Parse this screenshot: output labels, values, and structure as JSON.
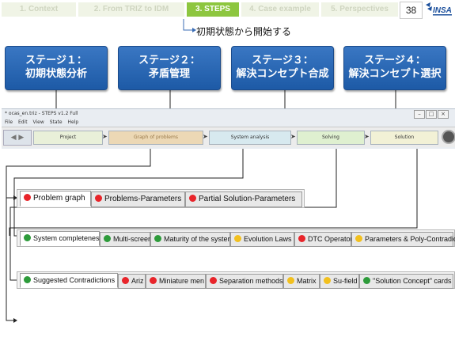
{
  "nav": {
    "tabs": [
      {
        "label": "1. Context",
        "active": false
      },
      {
        "label": "2. From TRIZ to IDM",
        "active": false
      },
      {
        "label": "3. STEPS",
        "active": true
      },
      {
        "label": "4. Case example",
        "active": false
      },
      {
        "label": "5. Perspectives",
        "active": false
      }
    ],
    "page_number": "38",
    "logo_text": "INSA"
  },
  "subtitle": "初期状態から開始する",
  "stages": [
    {
      "line1": "ステージ１：",
      "line2": "初期状態分析"
    },
    {
      "line1": "ステージ２：",
      "line2": "矛盾管理"
    },
    {
      "line1": "ステージ３：",
      "line2": "解決コンセプト合成"
    },
    {
      "line1": "ステージ４：",
      "line2": "解決コンセプト選択"
    }
  ],
  "app": {
    "title": "* ocas_en.triz - STEPS v1.2 Full",
    "menu": [
      "File",
      "Edit",
      "View",
      "State",
      "Help"
    ],
    "steps": [
      "Project",
      "Graph of problems",
      "System analysis",
      "Solving",
      "Solution"
    ]
  },
  "panel1": {
    "tabs": [
      {
        "label": "Problem graph",
        "dot": "red",
        "active": true
      },
      {
        "label": "Problems-Parameters",
        "dot": "red",
        "active": false
      },
      {
        "label": "Partial Solution-Parameters",
        "dot": "red",
        "active": false
      }
    ]
  },
  "panel2": {
    "tabs": [
      {
        "label": "System completeness",
        "dot": "green",
        "active": true
      },
      {
        "label": "Multi-screen",
        "dot": "green",
        "active": false
      },
      {
        "label": "Maturity of the system",
        "dot": "green",
        "active": false
      },
      {
        "label": "Evolution Laws",
        "dot": "yellow",
        "active": false
      },
      {
        "label": "DTC Operator",
        "dot": "red",
        "active": false
      },
      {
        "label": "Parameters & Poly-Contradictions",
        "dot": "yellow",
        "active": false
      }
    ]
  },
  "panel3": {
    "tabs": [
      {
        "label": "Suggested Contradictions",
        "dot": "green",
        "active": true
      },
      {
        "label": "Ariz",
        "dot": "red",
        "active": false
      },
      {
        "label": "Miniature men",
        "dot": "red",
        "active": false
      },
      {
        "label": "Separation methods",
        "dot": "red",
        "active": false
      },
      {
        "label": "Matrix",
        "dot": "yellow",
        "active": false
      },
      {
        "label": "Su-field",
        "dot": "yellow",
        "active": false
      },
      {
        "label": "\"Solution Concept\" cards",
        "dot": "green",
        "active": false
      }
    ]
  },
  "colors": {
    "red": "#e8242a",
    "green": "#2d9b3a",
    "yellow": "#f2c01e",
    "stage_blue": "#2a67b5",
    "nav_active": "#8dc63f"
  }
}
